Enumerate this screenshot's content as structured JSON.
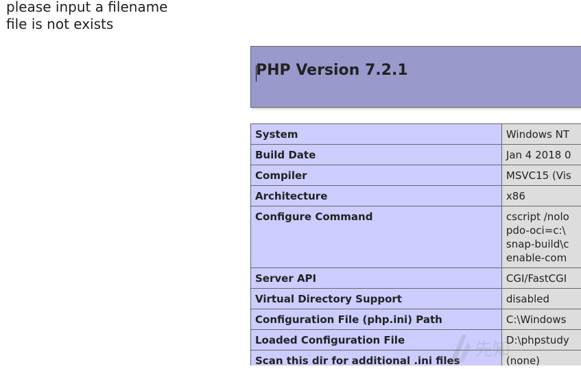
{
  "messages": {
    "line1": "please input a filename",
    "line2": "file is not exists"
  },
  "phpinfo": {
    "title": "PHP Version 7.2.1",
    "rows": [
      {
        "label": "System",
        "value": "Windows NT"
      },
      {
        "label": "Build Date",
        "value": "Jan 4 2018 0"
      },
      {
        "label": "Compiler",
        "value": "MSVC15 (Vis"
      },
      {
        "label": "Architecture",
        "value": "x86"
      },
      {
        "label": "Configure Command",
        "value": "cscript /nolo\npdo-oci=c:\\\nsnap-build\\c\nenable-com"
      },
      {
        "label": "Server API",
        "value": "CGI/FastCGI"
      },
      {
        "label": "Virtual Directory Support",
        "value": "disabled"
      },
      {
        "label": "Configuration File (php.ini) Path",
        "value": "C:\\Windows"
      },
      {
        "label": "Loaded Configuration File",
        "value": "D:\\phpstudy"
      },
      {
        "label": "Scan this dir for additional .ini files",
        "value": "(none)"
      }
    ]
  },
  "watermark": {
    "icon": "xianzhi-logo-icon",
    "text": "先知"
  }
}
